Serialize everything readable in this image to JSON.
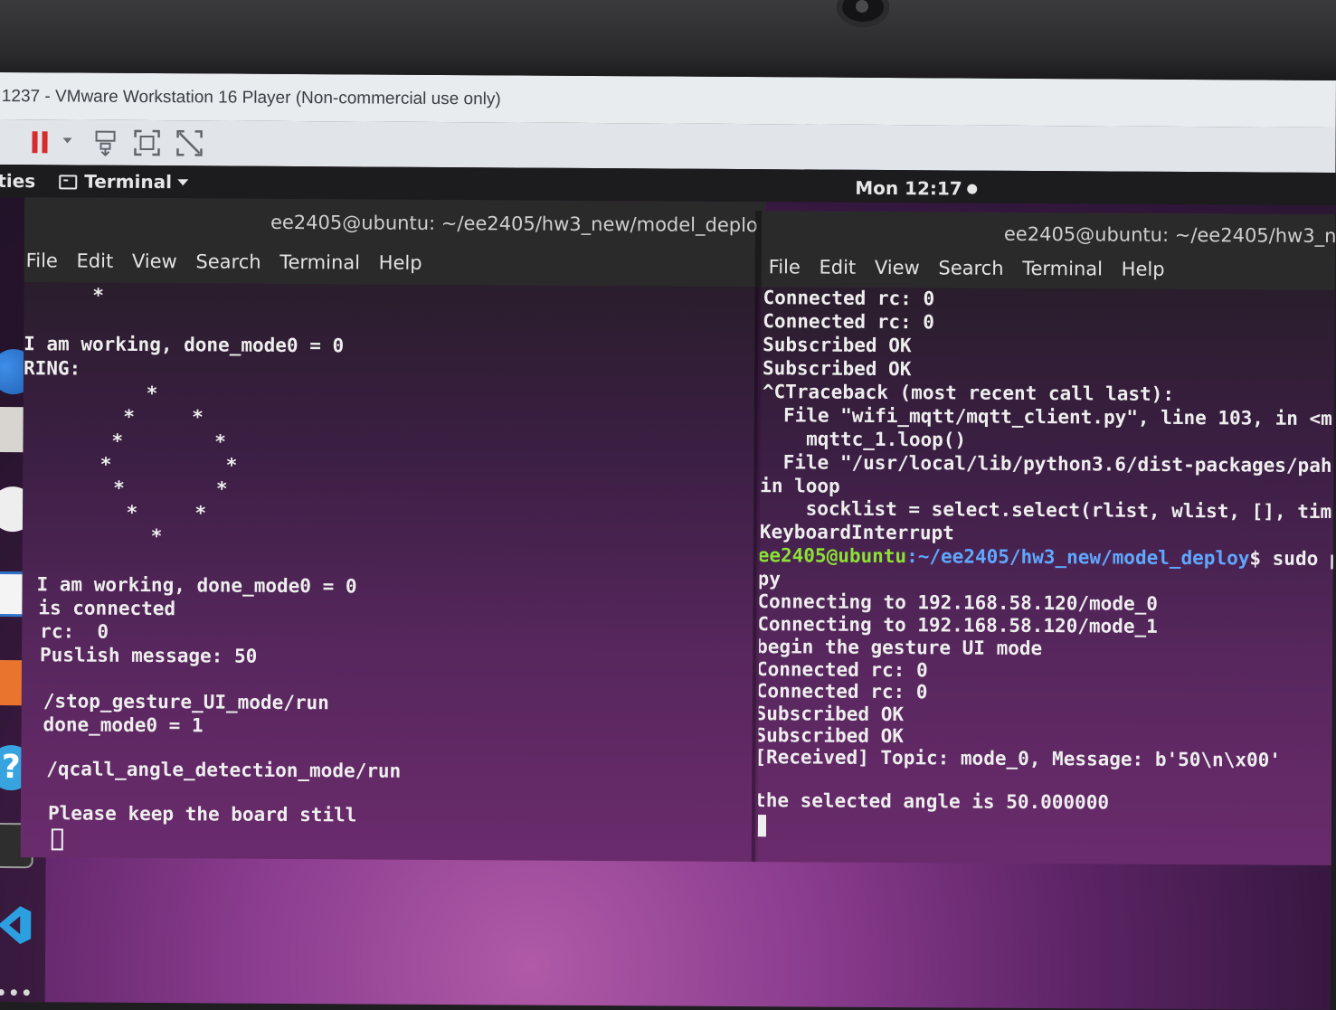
{
  "vmware": {
    "window_title": "1237 - VMware Workstation 16 Player (Non-commercial use only)"
  },
  "topbar": {
    "activities": "ties",
    "app_menu": "Terminal",
    "clock": "Mon 12:17"
  },
  "left_terminal": {
    "title": "ee2405@ubuntu: ~/ee2405/hw3_new/model_deplo",
    "menu": [
      "File",
      "Edit",
      "View",
      "Search",
      "Terminal",
      "Help"
    ],
    "lines": [
      "      *",
      "",
      "I am working, done_mode0 = 0",
      "RING:",
      "      *",
      "    *     *",
      "   *        *",
      "  *          *",
      "   *        *",
      "    *     *",
      "      *",
      "",
      "I am working, done_mode0 = 0",
      "is connected",
      "rc:  0",
      "Puslish message: 50",
      "",
      "/stop_gesture_UI_mode/run",
      "done_mode0 = 1",
      "",
      "/qcall_angle_detection_mode/run",
      "",
      "Please keep the board still"
    ]
  },
  "right_terminal": {
    "title": "ee2405@ubuntu: ~/ee2405/hw3_new",
    "menu": [
      "File",
      "Edit",
      "View",
      "Search",
      "Terminal",
      "Help"
    ],
    "lines_before_prompt": [
      "Connected rc: 0",
      "Connected rc: 0",
      "Subscribed OK",
      "Subscribed OK",
      "^CTraceback (most recent call last):",
      "  File \"wifi_mqtt/mqtt_client.py\", line 103, in <m",
      "    mqttc_1.loop()",
      "  File \"/usr/local/lib/python3.6/dist-packages/pah",
      "in loop",
      "    socklist = select.select(rlist, wlist, [], tim",
      "KeyboardInterrupt"
    ],
    "prompt_user": "ee2405@ubuntu",
    "prompt_path": ":~/ee2405/hw3_new/model_deploy",
    "prompt_cmd": "$ sudo p",
    "lines_after_prompt": [
      "py",
      "Connecting to 192.168.58.120/mode_0",
      "Connecting to 192.168.58.120/mode_1",
      "begin the gesture UI mode",
      "Connected rc: 0",
      "Connected rc: 0",
      "Subscribed OK",
      "Subscribed OK",
      "[Received] Topic: mode_0, Message: b'50\\n\\x00'",
      "",
      "the selected angle is 50.000000"
    ]
  },
  "dock": {
    "help_glyph": "?"
  },
  "colors": {
    "prompt_user": "#8ae234",
    "prompt_path": "#5fa8ff",
    "pause": "#d52d2d"
  }
}
